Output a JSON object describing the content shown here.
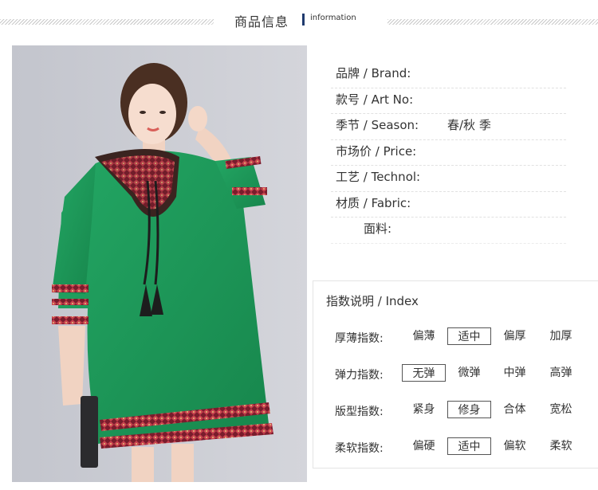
{
  "header": {
    "title": "商品信息",
    "subtitle": "information"
  },
  "specs": [
    {
      "label": "品牌 / Brand:",
      "value": ""
    },
    {
      "label": "款号 / Art No:",
      "value": ""
    },
    {
      "label": "季节 / Season:",
      "value": "春/秋 季"
    },
    {
      "label": "市场价 / Price:",
      "value": ""
    },
    {
      "label": "工艺 / Technol:",
      "value": ""
    },
    {
      "label": "材质 / Fabric:",
      "value": ""
    }
  ],
  "fabric_detail": {
    "label": "面料:",
    "value": ""
  },
  "index": {
    "title": "指数说明 / Index",
    "rows": [
      {
        "name": "厚薄指数:",
        "options": [
          "偏薄",
          "适中",
          "偏厚",
          "加厚"
        ],
        "selected": 1
      },
      {
        "name": "弹力指数:",
        "options": [
          "无弹",
          "微弹",
          "中弹",
          "高弹"
        ],
        "selected": 0
      },
      {
        "name": "版型指数:",
        "options": [
          "紧身",
          "修身",
          "合体",
          "宽松"
        ],
        "selected": 1
      },
      {
        "name": "柔软指数:",
        "options": [
          "偏硬",
          "适中",
          "偏软",
          "柔软"
        ],
        "selected": 1
      }
    ]
  },
  "colors": {
    "dress": "#1f9a5a",
    "accent_bar": "#1f3a6e",
    "photo_bg": "#c9cbd2"
  }
}
